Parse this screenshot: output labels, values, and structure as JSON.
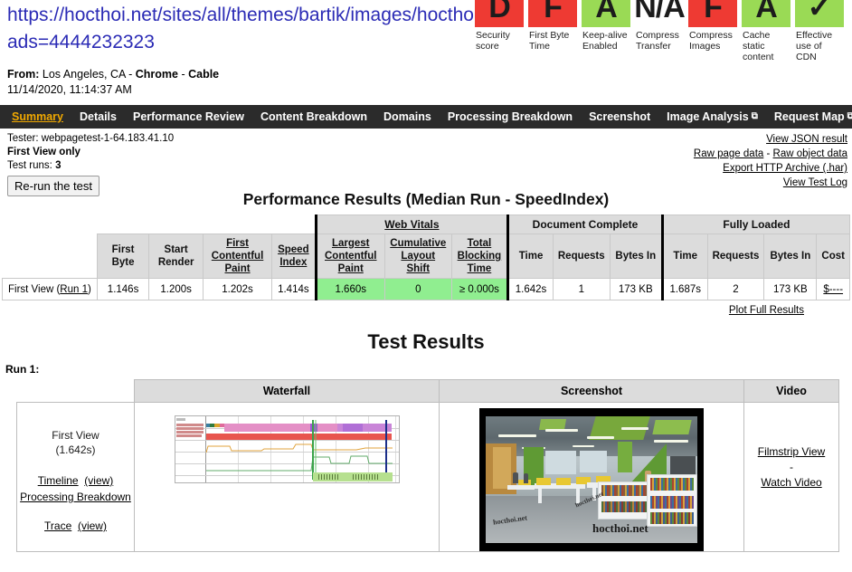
{
  "header": {
    "url_line1": "https://hocthoi.net/sites/all/themes/bartik/images/hocthoi.j",
    "url_line2": "ads=4444232323",
    "from_label": "From:",
    "from_location": "Los Angeles, CA",
    "from_sep1": " - ",
    "from_browser": "Chrome",
    "from_sep2": " - ",
    "from_connection": "Cable",
    "timestamp": "11/14/2020, 11:14:37 AM"
  },
  "grades": [
    {
      "letter": "D",
      "color": "#ee3a33",
      "style": "red",
      "label": "Security score"
    },
    {
      "letter": "F",
      "color": "#ee3a33",
      "style": "red",
      "label": "First Byte Time"
    },
    {
      "letter": "A",
      "color": "#9ada55",
      "style": "green",
      "label": "Keep-alive Enabled"
    },
    {
      "letter": "N/A",
      "color": "#ffffff",
      "style": "white",
      "label": "Compress Transfer"
    },
    {
      "letter": "F",
      "color": "#ee3a33",
      "style": "red",
      "label": "Compress Images"
    },
    {
      "letter": "A",
      "color": "#9ada55",
      "style": "green",
      "label": "Cache static content"
    },
    {
      "letter": "✓",
      "color": "#9ada55",
      "style": "green",
      "label": "Effective use of CDN"
    }
  ],
  "nav": {
    "active": "Summary",
    "tabs": [
      {
        "label": "Summary",
        "external": false
      },
      {
        "label": "Details",
        "external": false
      },
      {
        "label": "Performance Review",
        "external": false
      },
      {
        "label": "Content Breakdown",
        "external": false
      },
      {
        "label": "Domains",
        "external": false
      },
      {
        "label": "Processing Breakdown",
        "external": false
      },
      {
        "label": "Screenshot",
        "external": false
      },
      {
        "label": "Image Analysis",
        "external": true
      },
      {
        "label": "Request Map",
        "external": true
      }
    ]
  },
  "meta": {
    "tester": "Tester: webpagetest-1-64.183.41.10",
    "view_mode": "First View only",
    "test_runs_label": "Test runs:",
    "test_runs_value": "3",
    "rerun_button": "Re-run the test",
    "links": {
      "view_json": "View JSON result",
      "raw_page": "Raw page data",
      "raw_sep": " - ",
      "raw_object": "Raw object data",
      "export_har": "Export HTTP Archive (.har)",
      "test_log": "View Test Log"
    }
  },
  "performance": {
    "title": "Performance Results (Median Run - SpeedIndex)",
    "group_headers": {
      "web_vitals": "Web Vitals",
      "document_complete": "Document Complete",
      "fully_loaded": "Fully Loaded"
    },
    "columns": [
      "First Byte",
      "Start Render",
      "First Contentful Paint",
      "Speed Index",
      "Largest Contentful Paint",
      "Cumulative Layout Shift",
      "Total Blocking Time",
      "Time",
      "Requests",
      "Bytes In",
      "Time",
      "Requests",
      "Bytes In",
      "Cost"
    ],
    "row": {
      "label": "First View (",
      "run_link": "Run 1",
      "label_end": ")",
      "first_byte": "1.146s",
      "start_render": "1.200s",
      "first_contentful_paint": "1.202s",
      "speed_index": "1.414s",
      "largest_contentful_paint": "1.660s",
      "cumulative_layout_shift": "0",
      "total_blocking_time": "≥ 0.000s",
      "dc_time": "1.642s",
      "dc_requests": "1",
      "dc_bytes_in": "173 KB",
      "fl_time": "1.687s",
      "fl_requests": "2",
      "fl_bytes_in": "173 KB",
      "cost": "$----"
    },
    "plot_link": "Plot Full Results"
  },
  "test_results": {
    "title": "Test Results",
    "run_label": "Run 1:",
    "columns": {
      "waterfall": "Waterfall",
      "screenshot": "Screenshot",
      "video": "Video"
    },
    "first_view": {
      "name": "First View",
      "time": "(1.642s)",
      "timeline": "Timeline",
      "timeline_view": "(view)",
      "processing_breakdown": "Processing Breakdown",
      "trace": "Trace",
      "trace_view": "(view)"
    },
    "video_links": {
      "filmstrip": "Filmstrip View",
      "separator": "-",
      "watch": "Watch Video"
    },
    "screenshot_watermarks": [
      "hocthoi.net",
      "hocthoi.net",
      "hocthoi.net"
    ]
  },
  "colors": {
    "nav_bg": "#2b2b2b",
    "nav_active": "#f0a800",
    "grade_red": "#ee3a33",
    "grade_green": "#9ada55",
    "vital_green": "#90ee90",
    "table_header": "#dcdcdc",
    "link_blue": "#2b2bb5"
  }
}
